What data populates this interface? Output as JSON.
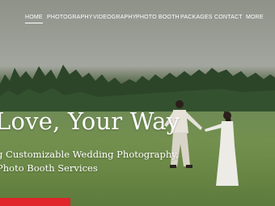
{
  "nav": {
    "items": [
      {
        "label": "HOME",
        "active": true
      },
      {
        "label": "PHOTOGRAPHY",
        "active": false
      },
      {
        "label": "VIDEOGRAPHY",
        "active": false
      },
      {
        "label": "PHOTO BOOTH",
        "active": false
      },
      {
        "label": "PACKAGES",
        "active": false
      },
      {
        "label": "CONTACT",
        "active": false
      },
      {
        "label": "MORE",
        "active": false
      }
    ]
  },
  "hero": {
    "headline": "Love, Your Way",
    "sub_line1": "g Customizable Wedding Photography,",
    "sub_line2": "Photo Booth Services"
  },
  "colors": {
    "accent": "#e0242a",
    "nav_text": "#ffffff"
  }
}
